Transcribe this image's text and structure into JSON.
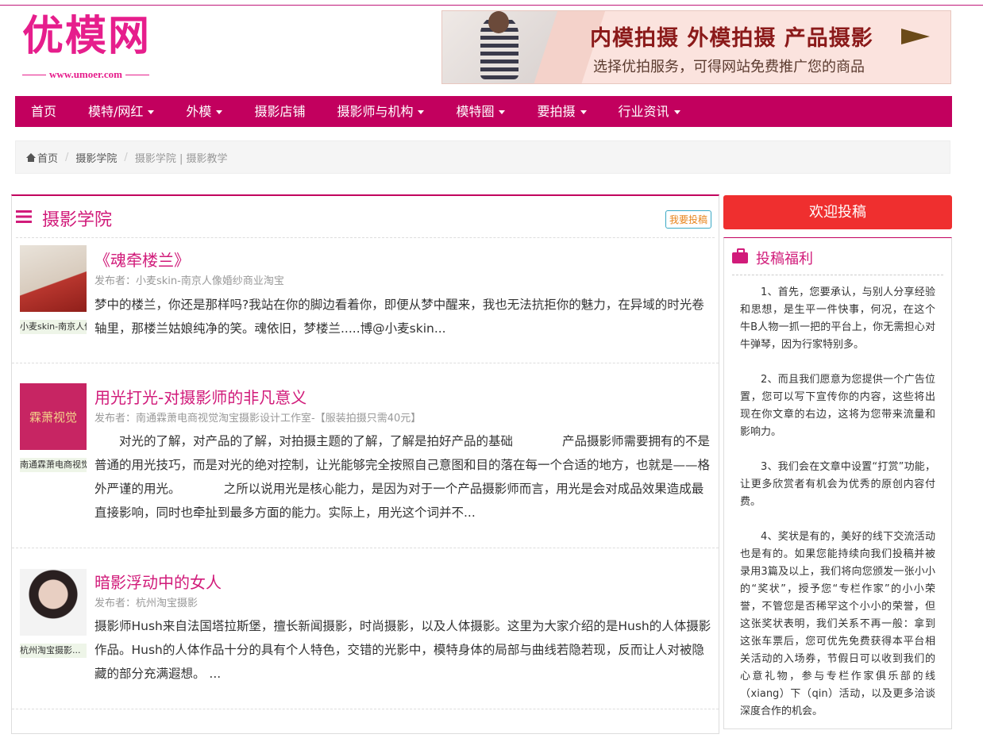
{
  "site": {
    "logo_text": "优模网",
    "logo_url": "www.umoer.com",
    "banner_line1": "内模拍摄 外模拍摄 产品摄影",
    "banner_line2": "选择优拍服务，可得网站免费推广您的商品"
  },
  "nav": [
    {
      "label": "首页",
      "dropdown": false
    },
    {
      "label": "模特/网红",
      "dropdown": true
    },
    {
      "label": "外模",
      "dropdown": true
    },
    {
      "label": "摄影店铺",
      "dropdown": false
    },
    {
      "label": "摄影师与机构",
      "dropdown": true
    },
    {
      "label": "模特圈",
      "dropdown": true
    },
    {
      "label": "要拍摄",
      "dropdown": true
    },
    {
      "label": "行业资讯",
      "dropdown": true
    }
  ],
  "breadcrumb": {
    "home": "首页",
    "section": "摄影学院",
    "current": "摄影学院 | 摄影教学"
  },
  "main": {
    "title": "摄影学院",
    "submit_label": "我要投稿",
    "posts": [
      {
        "title": "《魂牵楼兰》",
        "meta": "发布者：小麦skin-南京人像婚纱商业淘宝",
        "author_tag": "小麦skin-南京人像婚纱商业淘宝",
        "excerpt": "梦中的楼兰，你还是那样吗?我站在你的脚边看着你，即便从梦中醒来，我也无法抗拒你的魅力，在异域的时光卷轴里，那楼兰姑娘纯净的笑。魂依旧，梦楼兰.....博@小麦skin..."
      },
      {
        "title": "用光打光-对摄影师的非凡意义",
        "meta": "发布者：南通霖萧电商视觉淘宝摄影设计工作室-【服装拍摄只需40元】",
        "author_tag": "南通霖萧电商视觉淘宝摄影设计工作室",
        "thumb_text": "霖萧视觉",
        "excerpt": "　　对光的了解，对产品的了解，对拍摄主题的了解，了解是拍好产品的基础　　　　产品摄影师需要拥有的不是普通的用光技巧，而是对光的绝对控制，让光能够完全按照自己意图和目的落在每一个合适的地方，也就是——格外严谨的用光。　　　　之所以说用光是核心能力，是因为对于一个产品摄影师而言，用光是会对成品效果造成最直接影响，同时也牵扯到最多方面的能力。实际上，用光这个词并不..."
      },
      {
        "title": "暗影浮动中的女人",
        "meta": "发布者：杭州淘宝摄影",
        "author_tag": "杭州淘宝摄影...",
        "excerpt": "摄影师Hush来自法国塔拉斯堡，擅长新闻摄影，时尚摄影，以及人体摄影。这里为大家介绍的是Hush的人体摄影作品。Hush的人体作品十分的具有个人特色，交错的光影中，模特身体的局部与曲线若隐若现，反而让人对被隐藏的部分充满遐想。 ..."
      }
    ]
  },
  "sidebar": {
    "button_label": "欢迎投稿",
    "box_title": "投稿福利",
    "paragraphs": [
      "1、首先，您要承认，与别人分享经验和思想，是生平一件快事，何况，在这个牛B人物一抓一把的平台上，你无需担心对牛弹琴，因为行家特别多。",
      "2、而且我们愿意为您提供一个广告位置，您可以写下宣传你的内容，这些将出现在你文章的右边，这将为您带来流量和影响力。",
      "3、我们会在文章中设置“打赏”功能，让更多欣赏者有机会为优秀的原创内容付费。",
      "4、奖状是有的，美好的线下交流活动也是有的。如果您能持续向我们投稿并被录用3篇及以上，我们将向您颁发一张小小的“奖状”，授予您“专栏作家”的小小荣誉，不管您是否稀罕这个小小的荣誉，但这张奖状表明，我们关系不再一般：拿到这张车票后，您可优先免费获得本平台相关活动的入场券，节假日可以收到我们的心意礼物，参与专栏作家俱乐部的线（xiang）下（qin）活动，以及更多洽谈深度合作的机会。"
    ]
  },
  "colors": {
    "brand": "#c2005e",
    "title_pink": "#d11b7a",
    "submit_red": "#ef2f2f"
  }
}
